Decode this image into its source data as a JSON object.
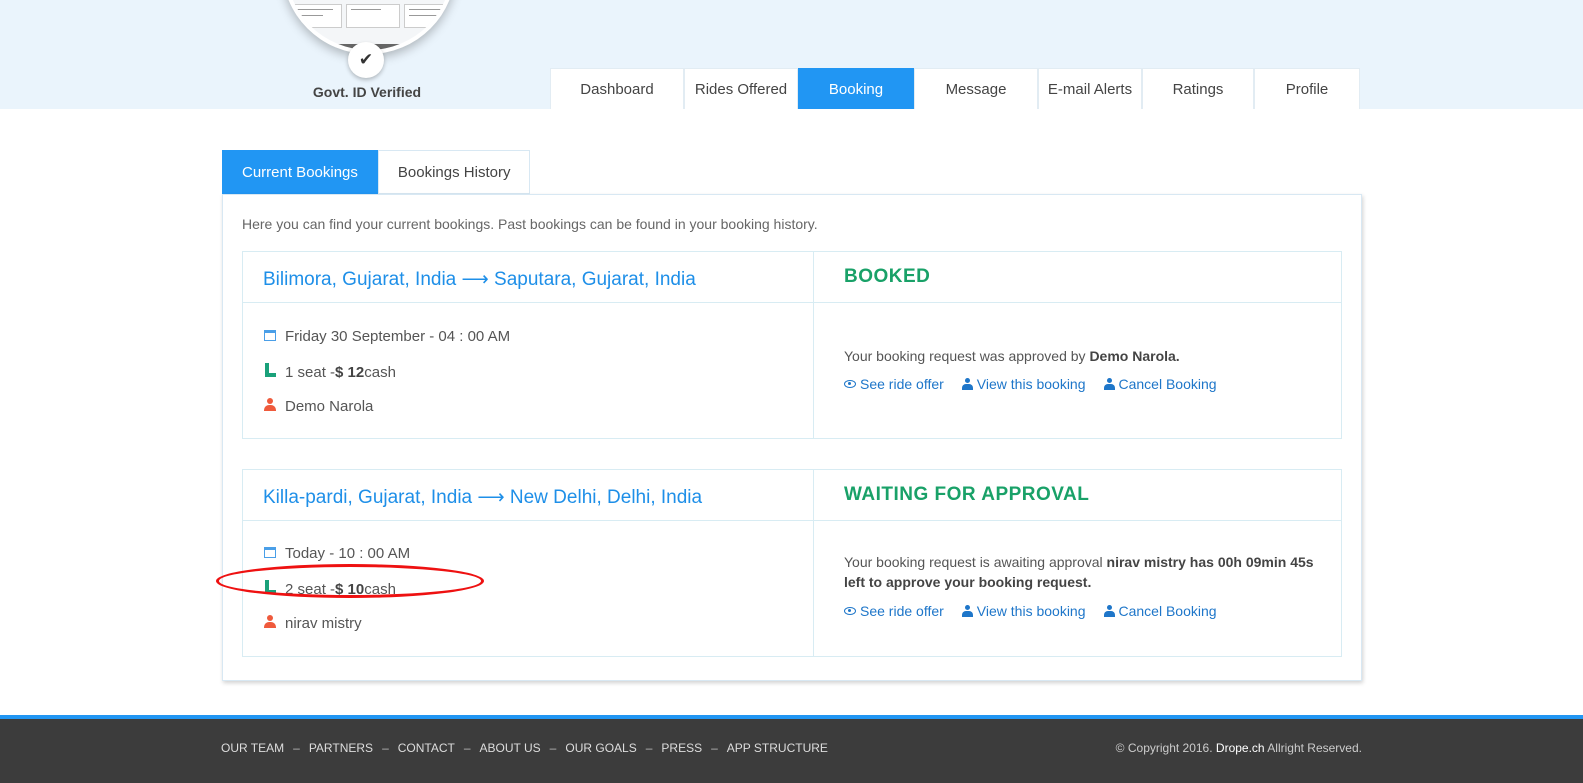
{
  "profile": {
    "verified_label": "Govt. ID Verified",
    "check_icon": "✔"
  },
  "nav": {
    "items": [
      {
        "label": "Dashboard"
      },
      {
        "label": "Rides Offered"
      },
      {
        "label": "Booking"
      },
      {
        "label": "Message"
      },
      {
        "label": "E-mail Alerts"
      },
      {
        "label": "Ratings"
      },
      {
        "label": "Profile"
      }
    ],
    "active": "Booking"
  },
  "subtabs": {
    "current": "Current Bookings",
    "history": "Bookings History"
  },
  "intro": "Here you can find your current bookings. Past bookings can be found in your booking history.",
  "bookings": [
    {
      "route": "Bilimora, Gujarat, India ⟶ Saputara, Gujarat, India",
      "status": "BOOKED",
      "date": "Friday 30 September - 04 : 00 AM",
      "seats_prefix": "1 seat - ",
      "price": "$ 12",
      "payment": " cash",
      "driver": "Demo Narola",
      "message": "Your booking request was approved by ",
      "message_bold": "Demo Narola.",
      "links": {
        "see": "See ride offer",
        "view": "View this booking",
        "cancel": "Cancel Booking"
      }
    },
    {
      "route": "Killa-pardi, Gujarat, India ⟶ New Delhi, Delhi, India",
      "status": "WAITING FOR APPROVAL",
      "date": "Today - 10 : 00 AM",
      "seats_prefix": "2 seat - ",
      "price": "$ 10",
      "payment": " cash",
      "driver": "nirav mistry",
      "message": "Your booking request is awaiting approval ",
      "message_bold": "nirav mistry has 00h 09min 45s left to approve your booking request.",
      "links": {
        "see": "See ride offer",
        "view": "View this booking",
        "cancel": "Cancel Booking"
      }
    }
  ],
  "footer": {
    "links": [
      "OUR TEAM",
      "PARTNERS",
      "CONTACT",
      "ABOUT US",
      "OUR GOALS",
      "PRESS",
      "APP STRUCTURE"
    ],
    "separator": "–",
    "copyright_prefix": "© Copyright 2016. ",
    "brand": "Drope.ch",
    "copyright_suffix": " Allright Reserved."
  },
  "colors": {
    "accent": "#2196f3",
    "status_green": "#19a168",
    "link": "#1e76c9",
    "footer_bg": "#3c3c3c",
    "highlight_oval": "#ee1111"
  },
  "icons": {
    "date": "calendar-icon",
    "seat": "seat-icon",
    "driver": "user-icon",
    "see": "eye-icon",
    "view": "user-icon",
    "cancel": "user-icon"
  }
}
